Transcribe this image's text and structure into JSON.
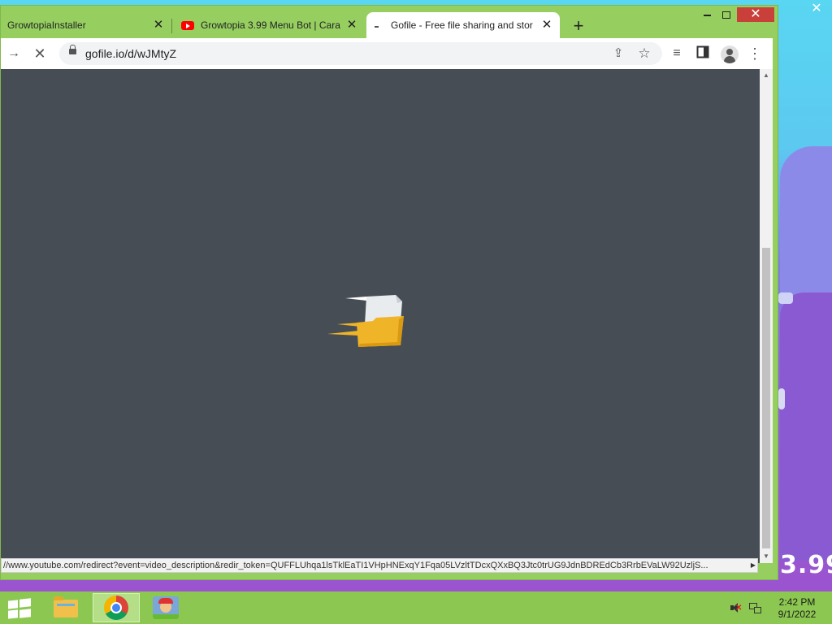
{
  "desktop": {
    "background_text": "3.99",
    "close_glyph": "✕"
  },
  "browser": {
    "tabs": [
      {
        "title": "GrowtopiaInstaller",
        "close": "✕"
      },
      {
        "title": "Growtopia 3.99 Menu Bot | Cara",
        "close": "✕",
        "icon": "youtube-icon"
      },
      {
        "title": "Gofile - Free file sharing and stor",
        "close": "✕",
        "icon": "loading-icon",
        "active": true
      }
    ],
    "new_tab": "+",
    "window_controls": {
      "close": "✕"
    },
    "toolbar": {
      "forward": "→",
      "stop": "✕",
      "url": "gofile.io/d/wJMtyZ",
      "share_icon": "⇪",
      "star_icon": "☆",
      "media_icon": "≡",
      "menu_icon": "⋮"
    },
    "status_url": "//www.youtube.com/redirect?event=video_description&redir_token=QUFFLUhqa1lsTklEaTI1VHpHNExqY1Fqa05LVzltTDcxQXxBQ3Jtc0trUG9JdnBDREdCb3RrbEVaLW92UzljS..."
  },
  "taskbar": {
    "apps": [
      "file-explorer",
      "google-chrome",
      "growtopia"
    ],
    "clock": {
      "time": "2:42 PM",
      "date": "9/1/2022"
    }
  },
  "colors": {
    "window_frame": "#96cf60",
    "page_background": "#464d55",
    "taskbar": "#8cc751",
    "accent_close": "#c9403a",
    "loader_folder": "#f0b429"
  }
}
